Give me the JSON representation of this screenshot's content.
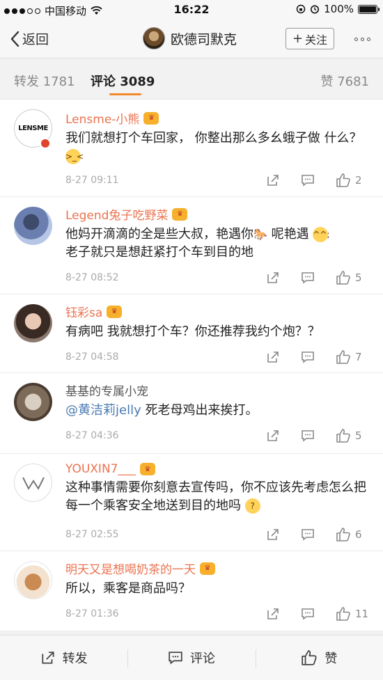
{
  "status_bar": {
    "carrier": "中国移动",
    "time": "16:22",
    "battery": "100%",
    "battery_level": 1.0
  },
  "nav": {
    "back_label": "返回",
    "title": "欧德司默克",
    "follow_label": "关注"
  },
  "tabs": [
    {
      "label": "转发 1781"
    },
    {
      "label": "评论 3089"
    },
    {
      "label": "赞 7681"
    }
  ],
  "comments": [
    {
      "name": "Lensme-小熊",
      "avatar_text": "LENSME",
      "text": "我们就想打个车回家， 你整出那么多幺蛾子做 什么？",
      "time": "8-27 09:11",
      "likes": "2"
    },
    {
      "name": "Legend兔子吃野菜",
      "text": "他妈开滴滴的全是些大叔，艳遇你",
      "text2": " 呢艳遇 ",
      "text3": "老子就只是想赶紧打个车到目的地",
      "time": "8-27 08:52",
      "likes": "5"
    },
    {
      "name": "钰彩sa",
      "text": "有病吧 我就想打个车？你还推荐我约个炮？？",
      "time": "8-27 04:58",
      "likes": "7"
    },
    {
      "name": "基基的专属小宠",
      "mention": "@黄洁莉jelly",
      "text": " 死老母鸡出来挨打。",
      "time": "8-27 04:36",
      "likes": "5"
    },
    {
      "name": "YOUXIN7___",
      "text": "这种事情需要你刻意去宣传吗，你不应该先考虑怎么把每一个乘客安全地送到目的地吗",
      "time": "8-27 02:55",
      "likes": "6"
    },
    {
      "name": "明天又是想喝奶茶的一天",
      "text": "所以，乘客是商品吗？",
      "time": "8-27 01:36",
      "likes": "11"
    }
  ],
  "bottom_bar": {
    "repost": "转发",
    "comment": "评论",
    "like": "赞"
  },
  "colors": {
    "accent": "#f48a27",
    "username": "#eb7350",
    "mention": "#4a7ab0"
  }
}
